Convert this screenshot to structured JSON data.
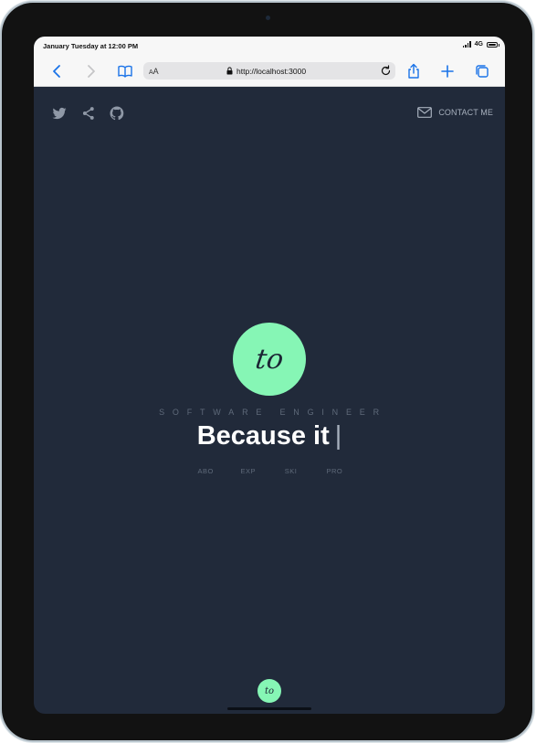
{
  "status_bar": {
    "time": "January Tuesday at 12:00 PM",
    "network": "4G",
    "battery_level": 0.95
  },
  "browser": {
    "text_size_label_small": "A",
    "text_size_label_large": "A",
    "url": "http://localhost:3000"
  },
  "page": {
    "social_icons": [
      "twitter-icon",
      "share-icon",
      "github-icon"
    ],
    "contact_label": "CONTACT ME",
    "logo_text": "to",
    "subtitle": "SOFTWARE ENGINEER",
    "headline": "Because it",
    "cursor": "|",
    "nav": [
      "ABO",
      "EXP",
      "SKI",
      "PRO"
    ],
    "footer_logo_text": "to"
  },
  "colors": {
    "background": "#212a3a",
    "accent": "#86f6b5",
    "muted": "#5f6a7a",
    "ios_blue": "#1a73e8"
  }
}
